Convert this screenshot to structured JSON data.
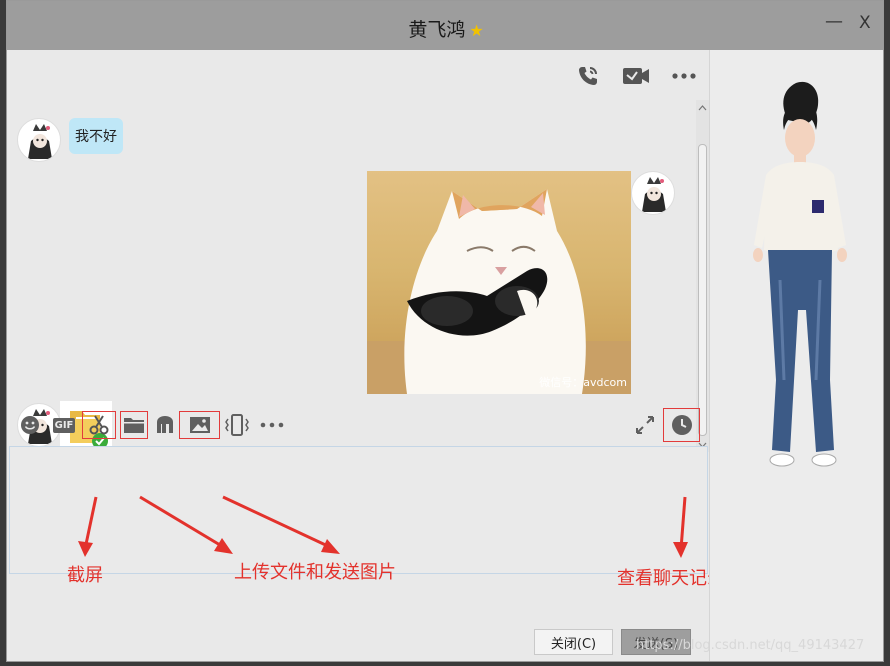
{
  "window": {
    "title": "黄飞鸿",
    "minimize": "—",
    "close": "X"
  },
  "messages": [
    {
      "side": "left",
      "type": "text",
      "text": "我不好"
    },
    {
      "side": "right",
      "type": "image",
      "watermark": "微信号：avdcom"
    },
    {
      "side": "left",
      "type": "file"
    }
  ],
  "toolbar": {
    "icons": [
      "emoji-icon",
      "gif-icon",
      "scissors-icon",
      "folder-icon",
      "music-icon",
      "image-icon",
      "shake-icon",
      "more-icon",
      "expand-icon",
      "clock-icon"
    ],
    "gif_label": "GIF"
  },
  "buttons": {
    "close_label": "关闭(C)",
    "send_label": "发送(S)"
  },
  "annotations": {
    "screenshot": "截屏",
    "upload": "上传文件和发送图片",
    "history": "查看聊天记录"
  },
  "footer_watermark": "https://blog.csdn.net/qq_49143427",
  "colors": {
    "annotation": "#e3322c",
    "bubble": "#bfe7f7",
    "titlebar": "#9d9d9d"
  }
}
